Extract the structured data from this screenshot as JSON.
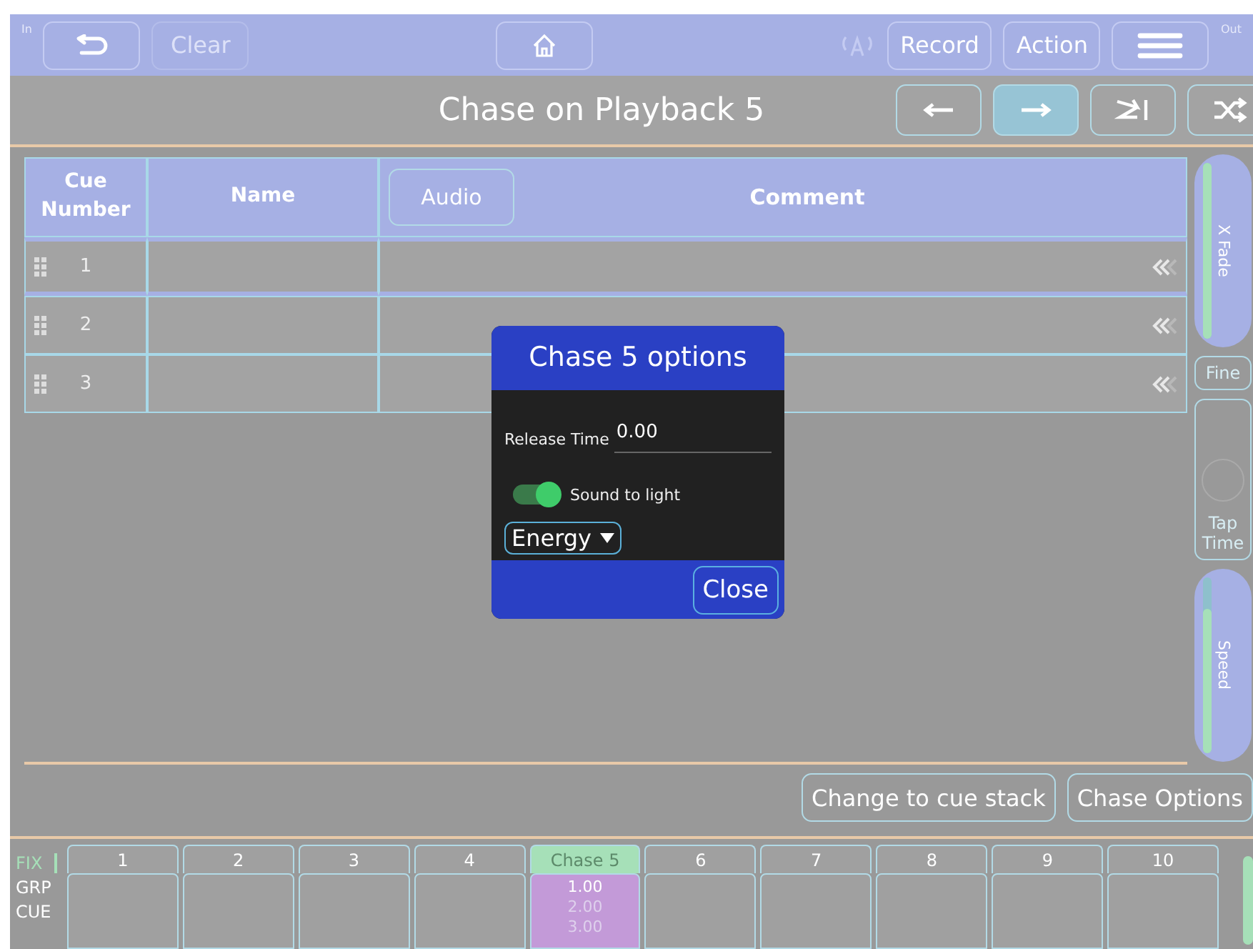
{
  "top_bar": {
    "in_label": "In",
    "out_label": "Out",
    "left_buttons": [
      {
        "kind": "back",
        "disabled": false
      },
      {
        "kind": "text",
        "label": "Clear",
        "disabled": true
      }
    ],
    "center_buttons": [
      {
        "kind": "home",
        "disabled": false
      }
    ],
    "right_buttons": [
      {
        "kind": "text",
        "label": "Record",
        "disabled": false
      },
      {
        "kind": "text",
        "label": "Action",
        "disabled": false
      },
      {
        "kind": "menu",
        "disabled": false
      }
    ]
  },
  "title_bar": {
    "title": "Chase on Playback 5",
    "nav_buttons": [
      {
        "kind": "prev",
        "selected": false
      },
      {
        "kind": "next",
        "selected": true
      },
      {
        "kind": "step",
        "selected": false
      },
      {
        "kind": "shuffle",
        "selected": false
      }
    ]
  },
  "table": {
    "columns": [
      {
        "kind": "header",
        "label": "Cue Number"
      },
      {
        "kind": "header",
        "label": "Name"
      },
      {
        "kind": "button",
        "label": "Audio"
      },
      {
        "kind": "header",
        "label": "Comment"
      }
    ],
    "rows": [
      {
        "cue": "1",
        "selected": true
      },
      {
        "cue": "2",
        "selected": false
      },
      {
        "cue": "3",
        "selected": false
      }
    ]
  },
  "side_panel": {
    "x_fade": {
      "label": "X Fade",
      "level": 1
    },
    "fine": "Fine",
    "tap": "Tap Time",
    "speed": {
      "label": "Speed",
      "level": 0.82
    }
  },
  "actions": [
    "Change to cue stack",
    "Chase Options"
  ],
  "dialog": {
    "title": "Chase 5 options",
    "release_label": "Release Time",
    "release_value": "0.00",
    "toggle": {
      "label": "Sound to light",
      "on": true
    },
    "mode": "Energy",
    "close": "Close"
  },
  "playbacks": {
    "modes": [
      {
        "label": "FIX",
        "selected": true
      },
      {
        "label": "GRP",
        "selected": false
      },
      {
        "label": "CUE",
        "selected": false
      }
    ],
    "slots": [
      {
        "label": "1",
        "selected": false
      },
      {
        "label": "2",
        "selected": false
      },
      {
        "label": "3",
        "selected": false
      },
      {
        "label": "4",
        "selected": false
      },
      {
        "label": "Chase 5",
        "selected": true,
        "cues": [
          {
            "label": "1.00",
            "active": true
          },
          {
            "label": "2.00",
            "active": false
          },
          {
            "label": "3.00",
            "active": false
          }
        ]
      },
      {
        "label": "6",
        "selected": false
      },
      {
        "label": "7",
        "selected": false
      },
      {
        "label": "8",
        "selected": false
      },
      {
        "label": "9",
        "selected": false
      },
      {
        "label": "10",
        "selected": false
      }
    ]
  }
}
